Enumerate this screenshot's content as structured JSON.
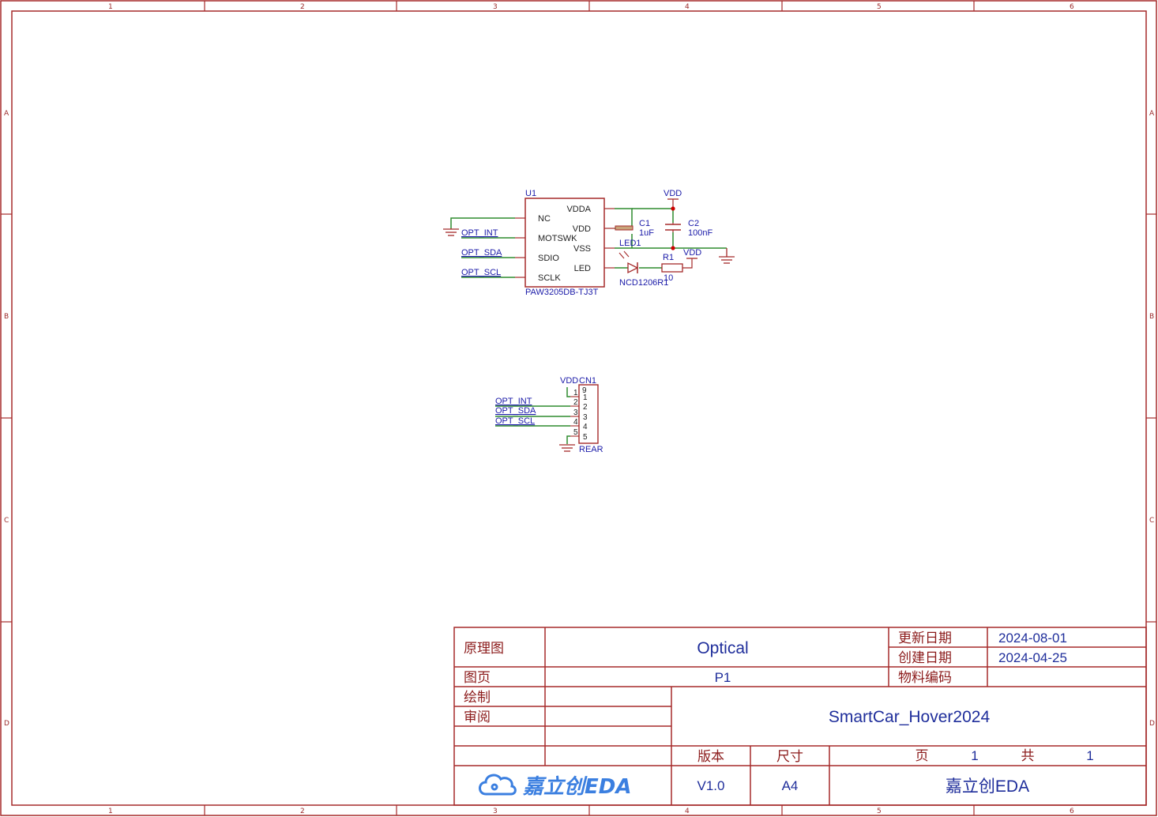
{
  "sheet": {
    "column_labels": [
      "1",
      "2",
      "3",
      "4",
      "5",
      "6"
    ],
    "row_labels": [
      "A",
      "B",
      "C",
      "D"
    ]
  },
  "schematic": {
    "u1": {
      "ref": "U1",
      "value": "PAW3205DB-TJ3T",
      "left_pins": [
        "NC",
        "MOTSWK",
        "SDIO",
        "SCLK"
      ],
      "right_pins": [
        "VDDA",
        "VDD",
        "VSS",
        "LED"
      ]
    },
    "c1": {
      "ref": "C1",
      "value": "1uF"
    },
    "c2": {
      "ref": "C2",
      "value": "100nF"
    },
    "r1": {
      "ref": "R1",
      "value": "10"
    },
    "led1": {
      "ref": "LED1",
      "value": "NCD1206R1"
    },
    "cn1": {
      "ref": "CN1",
      "value": "REAR",
      "pin_numbers": [
        "1",
        "2",
        "3",
        "4",
        "5"
      ],
      "pin_numbers_left": [
        "1",
        "2",
        "3",
        "4",
        "5"
      ],
      "mount_pin": "9"
    },
    "nets": {
      "vdd": "VDD",
      "opt_int": "OPT_INT",
      "opt_sda": "OPT_SDA",
      "opt_scl": "OPT_SCL"
    }
  },
  "title_block": {
    "schematic_label": "原理图",
    "schematic_value": "Optical",
    "page_label": "图页",
    "page_value": "P1",
    "drawn_label": "绘制",
    "review_label": "审阅",
    "updated_label": "更新日期",
    "updated_value": "2024-08-01",
    "created_label": "创建日期",
    "created_value": "2024-04-25",
    "material_label": "物料编码",
    "project": "SmartCar_Hover2024",
    "version_label": "版本",
    "version_value": "V1.0",
    "size_label": "尺寸",
    "size_value": "A4",
    "page_no_label": "页",
    "page_no_value": "1",
    "total_label": "共",
    "total_value": "1",
    "logo_text": "嘉立创EDA",
    "company": "嘉立创EDA"
  },
  "colors": {
    "border": "#a52a2a",
    "wire": "#2e8b2e",
    "net_label": "#1a1aa8",
    "junction": "#cc0000",
    "logo": "#3b7fe0"
  }
}
